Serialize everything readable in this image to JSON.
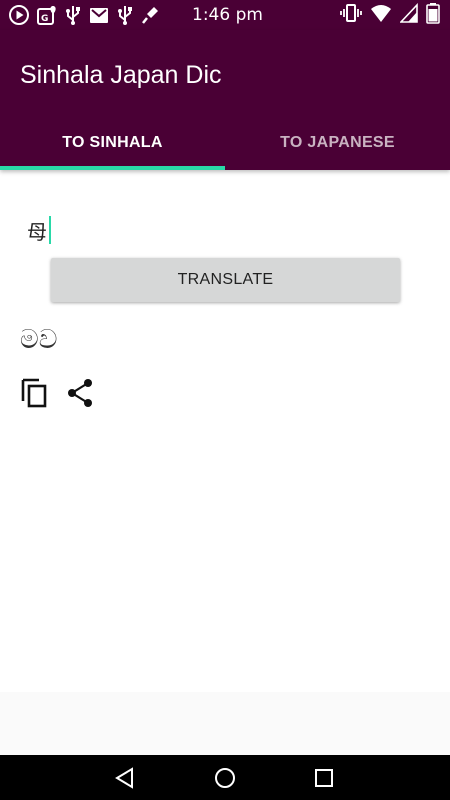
{
  "status_bar": {
    "time": "1:46 pm",
    "left_icons": [
      "play-store-icon",
      "maps-icon",
      "usb-icon",
      "gmail-icon",
      "usb-icon",
      "mic-off-icon"
    ],
    "right_icons": [
      "vibrate-icon",
      "wifi-icon",
      "signal-icon",
      "battery-icon"
    ]
  },
  "app_bar": {
    "title": "Sinhala Japan Dic",
    "color": "#4a0035"
  },
  "tabs": [
    {
      "label": "TO SINHALA",
      "selected": true
    },
    {
      "label": "TO JAPANESE",
      "selected": false
    }
  ],
  "accent_color": "#29d9a8",
  "input": {
    "value": "母"
  },
  "translate_button": {
    "label": "TRANSLATE"
  },
  "result": {
    "text": "මව"
  },
  "actions": [
    "copy-icon",
    "share-icon"
  ],
  "nav_bar": [
    "back-icon",
    "home-icon",
    "recents-icon"
  ]
}
